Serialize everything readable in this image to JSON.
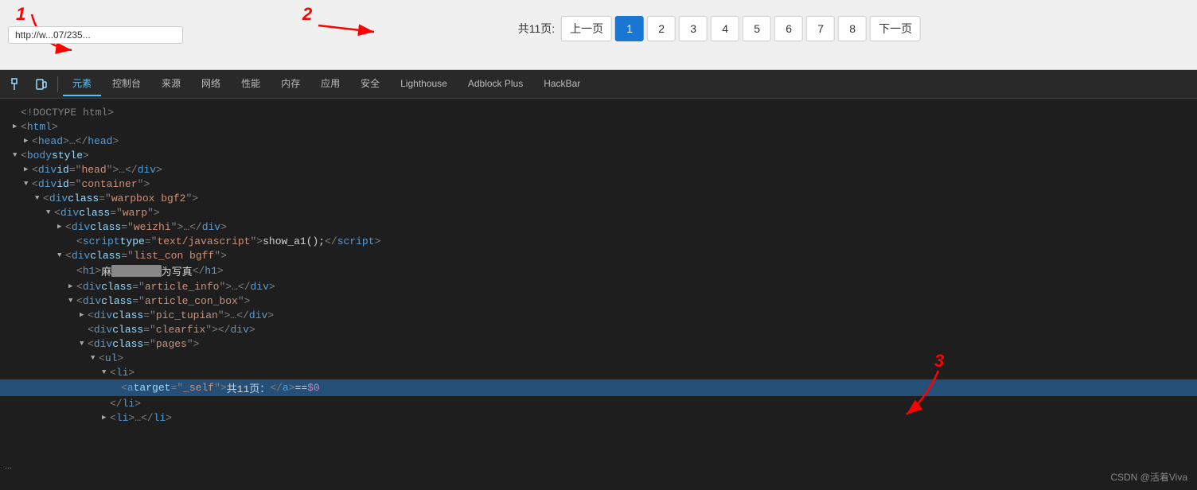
{
  "browser": {
    "address": "http://w...07/235...",
    "annotation1": "1",
    "annotation2": "2",
    "annotation3": "3"
  },
  "pagination": {
    "total_label": "共11页:",
    "prev_label": "上一页",
    "next_label": "下一页",
    "current_page": 1,
    "pages": [
      1,
      2,
      3,
      4,
      5,
      6,
      7,
      8
    ]
  },
  "devtools": {
    "tabs": [
      {
        "id": "element",
        "label": "元素",
        "active": true
      },
      {
        "id": "console",
        "label": "控制台",
        "active": false
      },
      {
        "id": "source",
        "label": "来源",
        "active": false
      },
      {
        "id": "network",
        "label": "网络",
        "active": false
      },
      {
        "id": "performance",
        "label": "性能",
        "active": false
      },
      {
        "id": "memory",
        "label": "内存",
        "active": false
      },
      {
        "id": "application",
        "label": "应用",
        "active": false
      },
      {
        "id": "security",
        "label": "安全",
        "active": false
      },
      {
        "id": "lighthouse",
        "label": "Lighthouse",
        "active": false
      },
      {
        "id": "adblock",
        "label": "Adblock Plus",
        "active": false
      },
      {
        "id": "hackbar",
        "label": "HackBar",
        "active": false
      }
    ]
  },
  "code": {
    "lines": [
      {
        "indent": 0,
        "triangle": "none",
        "content": "doctype"
      },
      {
        "indent": 0,
        "triangle": "right",
        "content": "html_open"
      },
      {
        "indent": 0,
        "triangle": "right",
        "content": "head"
      },
      {
        "indent": 0,
        "triangle": "down",
        "content": "body"
      },
      {
        "indent": 2,
        "triangle": "right",
        "content": "div_head"
      },
      {
        "indent": 2,
        "triangle": "down",
        "content": "div_container"
      },
      {
        "indent": 4,
        "triangle": "down",
        "content": "div_warpbox"
      },
      {
        "indent": 6,
        "triangle": "down",
        "content": "div_warp"
      },
      {
        "indent": 8,
        "triangle": "right",
        "content": "div_weizhi"
      },
      {
        "indent": 8,
        "triangle": "none",
        "content": "script_show"
      },
      {
        "indent": 8,
        "triangle": "down",
        "content": "div_list_con"
      },
      {
        "indent": 10,
        "triangle": "none",
        "content": "h1_mazi"
      },
      {
        "indent": 10,
        "triangle": "right",
        "content": "div_article_info"
      },
      {
        "indent": 10,
        "triangle": "down",
        "content": "div_article_con_box"
      },
      {
        "indent": 12,
        "triangle": "right",
        "content": "div_pic_tupian"
      },
      {
        "indent": 12,
        "triangle": "none",
        "content": "div_clearfix"
      },
      {
        "indent": 12,
        "triangle": "down",
        "content": "div_pages"
      },
      {
        "indent": 14,
        "triangle": "down",
        "content": "ul"
      },
      {
        "indent": 16,
        "triangle": "down",
        "content": "li_selected"
      },
      {
        "indent": 18,
        "triangle": "none",
        "content": "a_selected"
      },
      {
        "indent": 16,
        "triangle": "none",
        "content": "li_close"
      },
      {
        "indent": 16,
        "triangle": "right",
        "content": "li_more"
      }
    ],
    "selected_line_text": "<a target=\"_self\">共11页：</a> == $0"
  },
  "watermark": "CSDN @活着Viva"
}
